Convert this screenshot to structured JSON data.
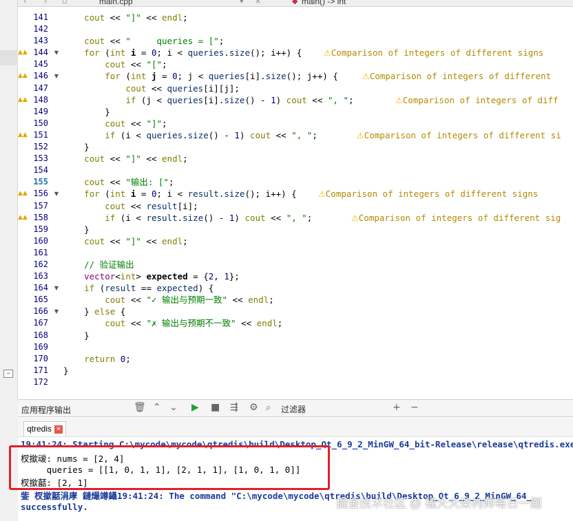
{
  "editor": {
    "file_tab": "main.cpp",
    "function_crumb": "main() -> int",
    "warning_text": "Comparison of integers of different signs"
  },
  "lines": [
    {
      "num": "141",
      "html": "    <span class=\"kw\">cout</span> &lt;&lt; <span class=\"str\">\"]\"</span> &lt;&lt; <span class=\"kw\">endl</span>;"
    },
    {
      "num": "142",
      "html": ""
    },
    {
      "num": "143",
      "html": "    <span class=\"kw\">cout</span> &lt;&lt; <span class=\"str\">\"     queries = [\"</span>;"
    },
    {
      "num": "144",
      "warn": true,
      "fold": true,
      "html": "    <span class=\"kw\">for</span> (<span class=\"kw\">int</span> <b>i</b> = <span class=\"num\">0</span>; i &lt; <span class=\"var\">queries</span>.<span class=\"var\">size</span>(); i++) {",
      "ann": "Comparison of integers of different signs",
      "annx": 378
    },
    {
      "num": "145",
      "html": "        <span class=\"kw\">cout</span> &lt;&lt; <span class=\"str\">\"[\"</span>;"
    },
    {
      "num": "146",
      "warn": true,
      "fold": true,
      "html": "        <span class=\"kw\">for</span> (<span class=\"kw\">int</span> <b>j</b> = <span class=\"num\">0</span>; j &lt; <span class=\"var\">queries</span>[i].<span class=\"var\">size</span>(); j++) {",
      "ann": "Comparison of integers of different",
      "annx": 434
    },
    {
      "num": "147",
      "html": "            <span class=\"kw\">cout</span> &lt;&lt; <span class=\"var\">queries</span>[i][j];"
    },
    {
      "num": "148",
      "warn": true,
      "html": "            <span class=\"kw\">if</span> (j &lt; <span class=\"var\">queries</span>[i].<span class=\"var\">size</span>() - <span class=\"num\">1</span>) <span class=\"kw\">cout</span> &lt;&lt; <span class=\"str\">\", \"</span>;",
      "ann": "Comparison of integers of diff",
      "annx": 482
    },
    {
      "num": "149",
      "html": "        }"
    },
    {
      "num": "150",
      "html": "        <span class=\"kw\">cout</span> &lt;&lt; <span class=\"str\">\"]\"</span>;"
    },
    {
      "num": "151",
      "warn": true,
      "html": "        <span class=\"kw\">if</span> (i &lt; <span class=\"var\">queries</span>.<span class=\"var\">size</span>() - <span class=\"num\">1</span>) <span class=\"kw\">cout</span> &lt;&lt; <span class=\"str\">\", \"</span>;",
      "ann": "Comparison of integers of different si",
      "annx": 426
    },
    {
      "num": "152",
      "html": "    }"
    },
    {
      "num": "153",
      "html": "    <span class=\"kw\">cout</span> &lt;&lt; <span class=\"str\">\"]\"</span> &lt;&lt; <span class=\"kw\">endl</span>;"
    },
    {
      "num": "154",
      "html": ""
    },
    {
      "num": "155",
      "cur": true,
      "html": "    <span class=\"kw\">cout</span> &lt;&lt; <span class=\"str\">\"输出: [\"</span>;"
    },
    {
      "num": "156",
      "warn": true,
      "fold": true,
      "html": "    <span class=\"kw\">for</span> (<span class=\"kw\">int</span> <b>i</b> = <span class=\"num\">0</span>; i &lt; <span class=\"var\">result</span>.<span class=\"var\">size</span>(); i++) {",
      "ann": "Comparison of integers of different signs",
      "annx": 370
    },
    {
      "num": "157",
      "html": "        <span class=\"kw\">cout</span> &lt;&lt; <span class=\"var\">result</span>[i];"
    },
    {
      "num": "158",
      "warn": true,
      "html": "        <span class=\"kw\">if</span> (i &lt; <span class=\"var\">result</span>.<span class=\"var\">size</span>() - <span class=\"num\">1</span>) <span class=\"kw\">cout</span> &lt;&lt; <span class=\"str\">\", \"</span>;",
      "ann": "Comparison of integers of different sig",
      "annx": 418
    },
    {
      "num": "159",
      "html": "    }"
    },
    {
      "num": "160",
      "html": "    <span class=\"kw\">cout</span> &lt;&lt; <span class=\"str\">\"]\"</span> &lt;&lt; <span class=\"kw\">endl</span>;"
    },
    {
      "num": "161",
      "html": ""
    },
    {
      "num": "162",
      "html": "    <span class=\"cm\">// 验证输出</span>"
    },
    {
      "num": "163",
      "html": "    <span class=\"typ\">vector</span>&lt;<span class=\"kw\">int</span>&gt; <b>expected</b> = {<span class=\"num\">2</span>, <span class=\"num\">1</span>};"
    },
    {
      "num": "164",
      "fold": true,
      "html": "    <span class=\"kw\">if</span> (<span class=\"var\">result</span> == <span class=\"var\">expected</span>) {"
    },
    {
      "num": "165",
      "html": "        <span class=\"kw\">cout</span> &lt;&lt; <span class=\"str\">\"✓ 输出与预期一致\"</span> &lt;&lt; <span class=\"kw\">endl</span>;"
    },
    {
      "num": "166",
      "fold": true,
      "html": "    } <span class=\"kw\">else</span> {"
    },
    {
      "num": "167",
      "html": "        <span class=\"kw\">cout</span> &lt;&lt; <span class=\"str\">\"✗ 输出与预期不一致\"</span> &lt;&lt; <span class=\"kw\">endl</span>;"
    },
    {
      "num": "168",
      "html": "    }"
    },
    {
      "num": "169",
      "html": ""
    },
    {
      "num": "170",
      "html": "    <span class=\"kw\">return</span> <span class=\"num\">0</span>;"
    },
    {
      "num": "171",
      "html": "}"
    },
    {
      "num": "172",
      "html": ""
    }
  ],
  "output_panel": {
    "title": "应用程序输出",
    "filter_label": "过滤器",
    "tab_name": "qtredis",
    "lines": [
      {
        "text": "19:41:24: Starting C:\\mycode\\mycode\\qtredis\\build\\Desktop_Qt_6_9_2_MinGW_64_bit-Release\\release\\qtredis.exe...",
        "blue": true
      },
      {
        "text": "杈撳叆: nums = [2, 4]",
        "blue": false
      },
      {
        "text": "     queries = [[1, 0, 1, 1], [2, 1, 1], [1, 0, 1, 0]]",
        "blue": false
      },
      {
        "text": "杈撳嚭: [2, 1]",
        "blue": false
      },
      {
        "text": "鈭 杈撳嚭涓庨 鏈熶竴鑷19:41:24: The command \"C:\\mycode\\mycode\\qtredis\\build\\Desktop_Qt_6_9_2_MinGW_64_",
        "blue": true
      },
      {
        "text": "successfully.",
        "blue": true
      }
    ]
  },
  "watermark": "掘金技术社区 @ 福大大架构师每日一题"
}
